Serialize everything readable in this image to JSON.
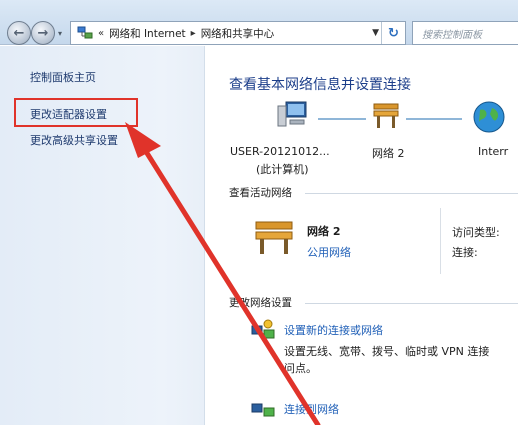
{
  "address_bar": {
    "overflow": "«",
    "crumbs": [
      "网络和 Internet",
      "网络和共享中心"
    ],
    "search_placeholder": "搜索控制面板"
  },
  "sidebar": {
    "home": "控制面板主页",
    "items": [
      {
        "label": "更改适配器设置",
        "highlighted": true
      },
      {
        "label": "更改高级共享设置",
        "highlighted": false
      }
    ]
  },
  "main": {
    "title": "查看基本网络信息并设置连接",
    "map": {
      "computer_name": "USER-20121012...",
      "computer_note": "(此计算机)",
      "network_name": "网络  2",
      "internet_label": "Interr"
    },
    "active_networks": {
      "title": "查看活动网络",
      "network": {
        "name": "网络  2",
        "type": "公用网络"
      },
      "access_type_label": "访问类型:",
      "connection_label": "连接:"
    },
    "change_settings": {
      "title": "更改网络设置",
      "tasks": [
        {
          "link": "设置新的连接或网络",
          "desc_line1": "设置无线、宽带、拨号、临时或 VPN 连接",
          "desc_line2": "问点。"
        },
        {
          "link": "连接到网络",
          "desc_line1": "",
          "desc_line2": ""
        }
      ]
    }
  },
  "colors": {
    "highlight": "#e0332a",
    "link": "#1f5fb7",
    "title": "#1c3e8a"
  }
}
